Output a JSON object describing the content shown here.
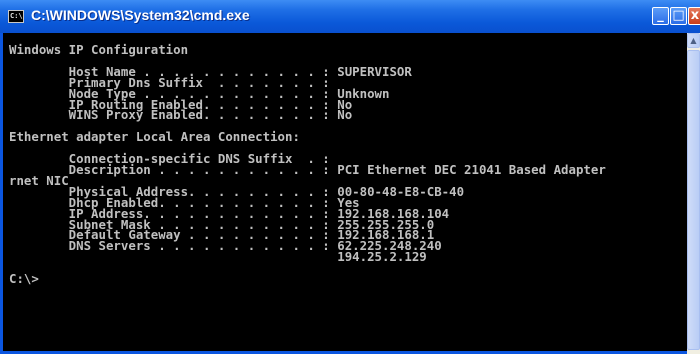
{
  "window": {
    "title": "C:\\WINDOWS\\System32\\cmd.exe",
    "icon": "cmd-icon",
    "controls": {
      "minimize": "_",
      "maximize": "□",
      "close": "x"
    }
  },
  "console": {
    "lines": [
      "Windows IP Configuration",
      "",
      "        Host Name . . . . . . . . . . . . : SUPERVISOR",
      "        Primary Dns Suffix  . . . . . . . :",
      "        Node Type . . . . . . . . . . . . : Unknown",
      "        IP Routing Enabled. . . . . . . . : No",
      "        WINS Proxy Enabled. . . . . . . . : No",
      "",
      "Ethernet adapter Local Area Connection:",
      "",
      "        Connection-specific DNS Suffix  . :",
      "        Description . . . . . . . . . . . : PCI Ethernet DEC 21041 Based Adapter",
      "rnet NIC",
      "        Physical Address. . . . . . . . . : 00-80-48-E8-CB-40",
      "        Dhcp Enabled. . . . . . . . . . . : Yes",
      "        IP Address. . . . . . . . . . . . : 192.168.168.104",
      "        Subnet Mask . . . . . . . . . . . : 255.255.255.0",
      "        Default Gateway . . . . . . . . . : 192.168.168.1",
      "        DNS Servers . . . . . . . . . . . : 62.225.248.240",
      "                                            194.25.2.129",
      "",
      "C:\\>"
    ]
  },
  "scrollbar": {
    "up_arrow": "▲"
  },
  "colors": {
    "titlebar": "#0a58d8",
    "console_bg": "#000000",
    "console_fg": "#c0c0c0"
  }
}
